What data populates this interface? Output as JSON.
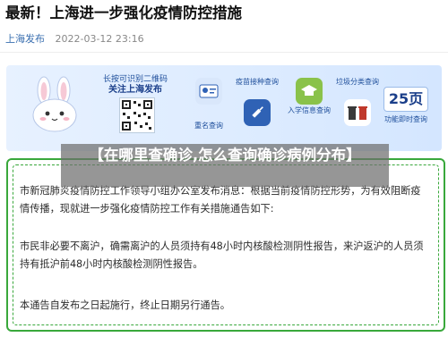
{
  "article": {
    "headline": "最新！上海进一步强化疫情防控措施",
    "source": "上海发布",
    "timestamp": "2022-03-12 23:16"
  },
  "banner": {
    "promo_line1": "长按可识别二维码",
    "promo_line2": "关注上海发布",
    "features": [
      {
        "label": "重名查询",
        "icon": "id-card-icon"
      },
      {
        "label": "疫苗接种查询",
        "icon": "syringe-icon"
      },
      {
        "label": "入学信息查询",
        "icon": "graduation-icon"
      },
      {
        "label": "垃圾分类查询",
        "icon": "trash-bins-icon"
      }
    ],
    "pages_value": "25页",
    "pages_label": "功能即时查询"
  },
  "overlay_title": "【在哪里查确诊,怎么查询确诊病例分布】",
  "notice": {
    "paragraphs": [
      "市新冠肺炎疫情防控工作领导小组办公室发布消息：根据当前疫情防控形势，为有效阻断疫情传播，现就进一步强化疫情防控工作有关措施通告如下:",
      "市民非必要不离沪，确需离沪的人员须持有48小时内核酸检测阴性报告，来沪返沪的人员须持有抵沪前48小时内核酸检测阴性报告。",
      "本通告自发布之日起施行，终止日期另行通告。"
    ]
  },
  "colors": {
    "accent_blue": "#1b3f8a",
    "notice_border": "#39a83b"
  }
}
